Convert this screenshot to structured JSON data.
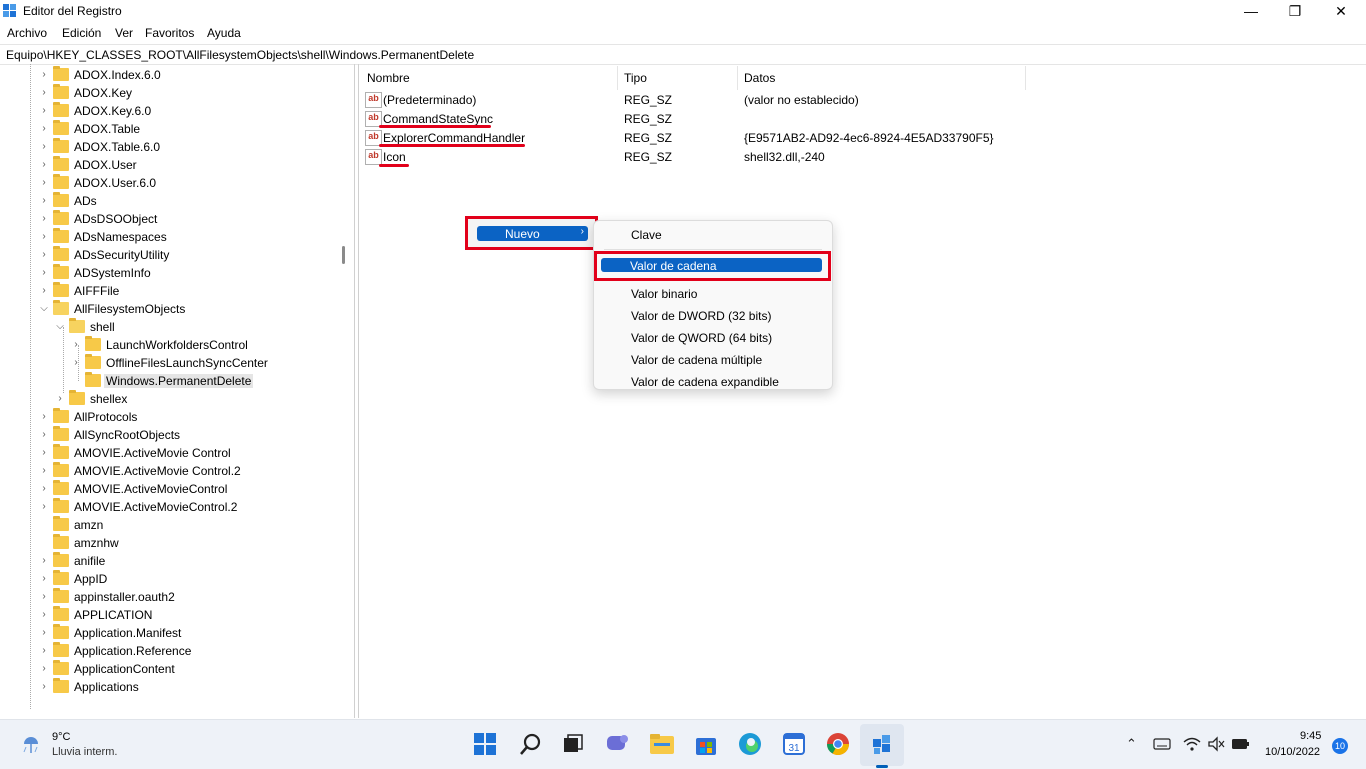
{
  "window": {
    "title": "Editor del Registro",
    "minimize_glyph": "—",
    "maximize_glyph": "❐",
    "close_glyph": "✕"
  },
  "menubar": [
    "Archivo",
    "Edición",
    "Ver",
    "Favoritos",
    "Ayuda"
  ],
  "address": "Equipo\\HKEY_CLASSES_ROOT\\AllFilesystemObjects\\shell\\Windows.PermanentDelete",
  "tree": [
    {
      "label": "ADOX.Index.6.0",
      "chevron": true
    },
    {
      "label": "ADOX.Key",
      "chevron": true
    },
    {
      "label": "ADOX.Key.6.0",
      "chevron": true
    },
    {
      "label": "ADOX.Table",
      "chevron": true
    },
    {
      "label": "ADOX.Table.6.0",
      "chevron": true
    },
    {
      "label": "ADOX.User",
      "chevron": true
    },
    {
      "label": "ADOX.User.6.0",
      "chevron": true
    },
    {
      "label": "ADs",
      "chevron": true
    },
    {
      "label": "ADsDSOObject",
      "chevron": true
    },
    {
      "label": "ADsNamespaces",
      "chevron": true
    },
    {
      "label": "ADsSecurityUtility",
      "chevron": true
    },
    {
      "label": "ADSystemInfo",
      "chevron": true
    },
    {
      "label": "AIFFFile",
      "chevron": true
    },
    {
      "label": "AllFilesystemObjects",
      "chevron": true,
      "expanded": true
    },
    {
      "label": "shell",
      "chevron": true,
      "expanded": true,
      "level": 1
    },
    {
      "label": "LaunchWorkfoldersControl",
      "chevron": true,
      "level": 2
    },
    {
      "label": "OfflineFilesLaunchSyncCenter",
      "chevron": true,
      "level": 2
    },
    {
      "label": "Windows.PermanentDelete",
      "chevron": false,
      "level": 2,
      "selected": true
    },
    {
      "label": "shellex",
      "chevron": true,
      "level": 1
    },
    {
      "label": "AllProtocols",
      "chevron": true
    },
    {
      "label": "AllSyncRootObjects",
      "chevron": true
    },
    {
      "label": "AMOVIE.ActiveMovie Control",
      "chevron": true
    },
    {
      "label": "AMOVIE.ActiveMovie Control.2",
      "chevron": true
    },
    {
      "label": "AMOVIE.ActiveMovieControl",
      "chevron": true
    },
    {
      "label": "AMOVIE.ActiveMovieControl.2",
      "chevron": true
    },
    {
      "label": "amzn",
      "chevron": false
    },
    {
      "label": "amznhw",
      "chevron": false
    },
    {
      "label": "anifile",
      "chevron": true
    },
    {
      "label": "AppID",
      "chevron": true
    },
    {
      "label": "appinstaller.oauth2",
      "chevron": true
    },
    {
      "label": "APPLICATION",
      "chevron": true
    },
    {
      "label": "Application.Manifest",
      "chevron": true
    },
    {
      "label": "Application.Reference",
      "chevron": true
    },
    {
      "label": "ApplicationContent",
      "chevron": true
    },
    {
      "label": "Applications",
      "chevron": true
    }
  ],
  "list": {
    "columns": [
      "Nombre",
      "Tipo",
      "Datos"
    ],
    "icon_text": "ab",
    "rows": [
      {
        "name": "(Predeterminado)",
        "type": "REG_SZ",
        "data": "(valor no establecido)"
      },
      {
        "name": "CommandStateSync",
        "type": "REG_SZ",
        "data": ""
      },
      {
        "name": "ExplorerCommandHandler",
        "type": "REG_SZ",
        "data": "{E9571AB2-AD92-4ec6-8924-4E5AD33790F5}"
      },
      {
        "name": "Icon",
        "type": "REG_SZ",
        "data": "shell32.dll,-240"
      }
    ]
  },
  "context_menu": {
    "nuevo": "Nuevo",
    "arrow": "›",
    "submenu": [
      "Clave",
      "Valor de cadena",
      "Valor binario",
      "Valor de DWORD (32 bits)",
      "Valor de QWORD (64 bits)",
      "Valor de cadena múltiple",
      "Valor de cadena expandible"
    ],
    "selected": "Valor de cadena"
  },
  "taskbar": {
    "weather_temp": "9°C",
    "weather_desc": "Lluvia interm.",
    "time": "9:45",
    "date": "10/10/2022",
    "notifications": "10",
    "calendar_day": "31"
  },
  "colors": {
    "accent": "#0b63c4",
    "highlight_box": "#e2001a",
    "folder": "#f7c948"
  }
}
